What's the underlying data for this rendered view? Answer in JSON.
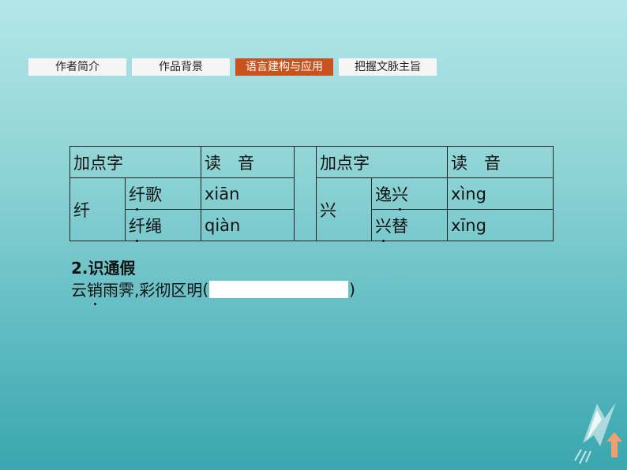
{
  "tabs": [
    {
      "label": "作者简介",
      "active": false
    },
    {
      "label": "作品背景",
      "active": false
    },
    {
      "label": "语言建构与应用",
      "active": true
    },
    {
      "label": "把握文脉主旨",
      "active": false
    }
  ],
  "table": {
    "header": {
      "char_label": "加点字",
      "reading_label": "读　音"
    },
    "left": {
      "char": "纤",
      "rows": [
        {
          "pre": "",
          "dot": "纤",
          "post": "歌",
          "reading": "xiān"
        },
        {
          "pre": "",
          "dot": "纤",
          "post": "绳",
          "reading": "qiàn"
        }
      ]
    },
    "right": {
      "char": "兴",
      "rows": [
        {
          "pre": "逸",
          "dot": "兴",
          "post": "",
          "reading": "xìng"
        },
        {
          "pre": "",
          "dot": "兴",
          "post": "替",
          "reading": "xīng"
        }
      ]
    }
  },
  "section": {
    "heading": "2.识通假",
    "sentence": {
      "before": "云",
      "dot": "销",
      "after": "雨霁,彩彻区明",
      "paren_open": "(",
      "paren_close": ")"
    }
  },
  "colors": {
    "active_tab": "#c8531e",
    "tab_bg": "#f5f5f5",
    "arrow": "#f0a070"
  }
}
